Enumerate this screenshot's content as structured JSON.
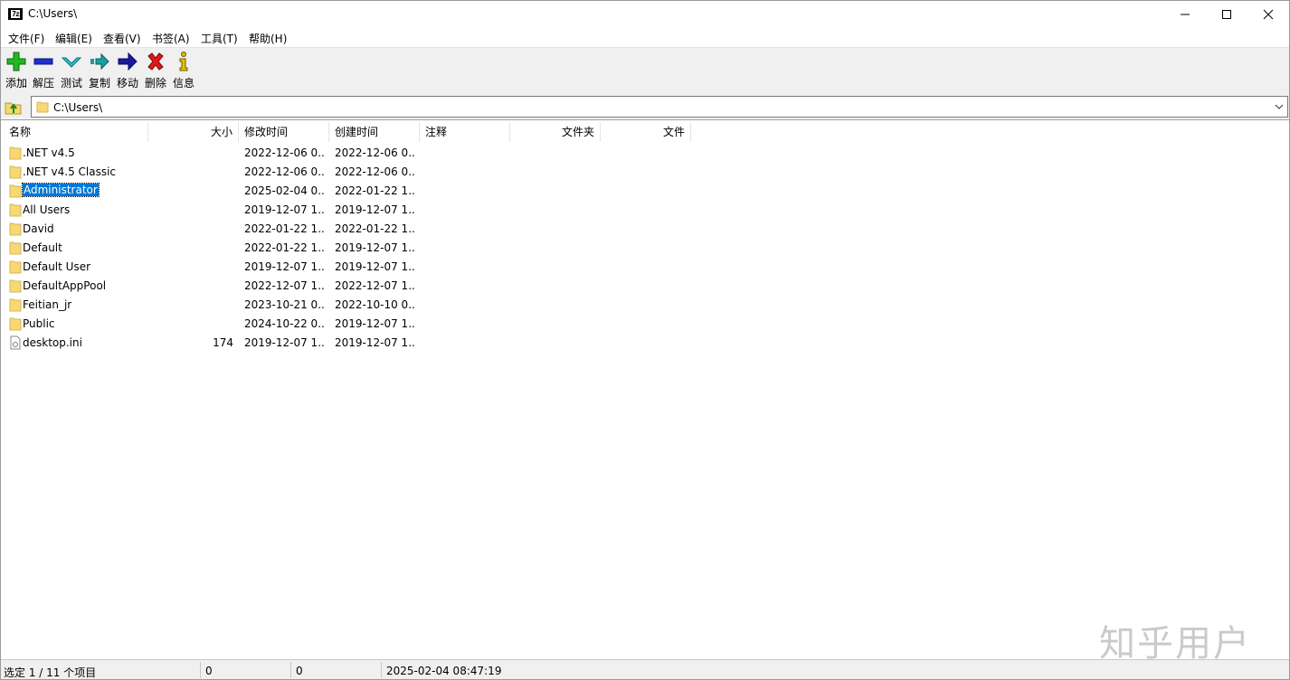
{
  "window": {
    "title": "C:\\Users\\"
  },
  "menu": [
    "文件(F)",
    "编辑(E)",
    "查看(V)",
    "书签(A)",
    "工具(T)",
    "帮助(H)"
  ],
  "toolbar": {
    "add": "添加",
    "extract": "解压",
    "test": "测试",
    "copy": "复制",
    "move": "移动",
    "delete": "删除",
    "info": "信息"
  },
  "address": {
    "path": "C:\\Users\\"
  },
  "columns": {
    "name": "名称",
    "size": "大小",
    "modified": "修改时间",
    "created": "创建时间",
    "comment": "注释",
    "folders": "文件夹",
    "files": "文件"
  },
  "rows": [
    {
      "name": ".NET v4.5",
      "size": "",
      "modified": "2022-12-06 0...",
      "created": "2022-12-06 0...",
      "type": "folder"
    },
    {
      "name": ".NET v4.5 Classic",
      "size": "",
      "modified": "2022-12-06 0...",
      "created": "2022-12-06 0...",
      "type": "folder"
    },
    {
      "name": "Administrator",
      "size": "",
      "modified": "2025-02-04 0...",
      "created": "2022-01-22 1...",
      "type": "folder",
      "selected": true
    },
    {
      "name": "All Users",
      "size": "",
      "modified": "2019-12-07 1...",
      "created": "2019-12-07 1...",
      "type": "folder"
    },
    {
      "name": "David",
      "size": "",
      "modified": "2022-01-22 1...",
      "created": "2022-01-22 1...",
      "type": "folder"
    },
    {
      "name": "Default",
      "size": "",
      "modified": "2022-01-22 1...",
      "created": "2019-12-07 1...",
      "type": "folder"
    },
    {
      "name": "Default User",
      "size": "",
      "modified": "2019-12-07 1...",
      "created": "2019-12-07 1...",
      "type": "folder"
    },
    {
      "name": "DefaultAppPool",
      "size": "",
      "modified": "2022-12-07 1...",
      "created": "2022-12-07 1...",
      "type": "folder"
    },
    {
      "name": "Feitian_jr",
      "size": "",
      "modified": "2023-10-21 0...",
      "created": "2022-10-10 0...",
      "type": "folder"
    },
    {
      "name": "Public",
      "size": "",
      "modified": "2024-10-22 0...",
      "created": "2019-12-07 1...",
      "type": "folder"
    },
    {
      "name": "desktop.ini",
      "size": "174",
      "modified": "2019-12-07 1...",
      "created": "2019-12-07 1...",
      "type": "file"
    }
  ],
  "status": {
    "selection": "选定 1 / 11 个项目",
    "size": "0",
    "packed": "0",
    "datetime": "2025-02-04 08:47:19"
  },
  "watermark": "知乎用户",
  "colors": {
    "selection": "#0078d7",
    "folder": "#f8d775",
    "toolbar_bg": "#f0f0f0"
  }
}
